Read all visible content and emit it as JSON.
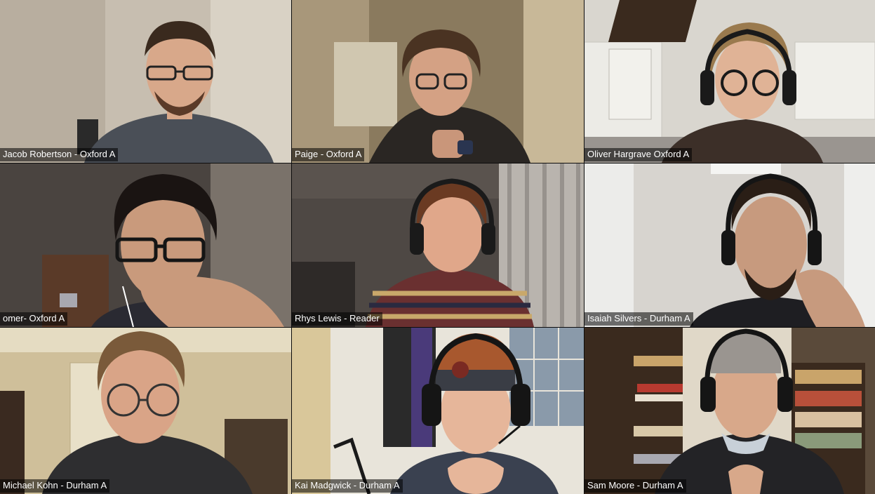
{
  "participants": [
    {
      "name": "Jacob Robertson - Oxford A",
      "bg": "#c9bfb0",
      "skin": "#d8a88a",
      "hair": "#3a2a1e",
      "shirt": "#4a4f57",
      "glasses": true,
      "headphones": false,
      "hat": false
    },
    {
      "name": "Paige - Oxford A",
      "bg": "#8c7a5c",
      "skin": "#d4a184",
      "hair": "#4a3322",
      "shirt": "#2a2623",
      "glasses": true,
      "headphones": false,
      "hat": false
    },
    {
      "name": "Oliver Hargrave Oxford A",
      "bg": "#d9d6cf",
      "skin": "#e0b396",
      "hair": "#9a7a4e",
      "shirt": "#3c2f28",
      "glasses": true,
      "headphones": true,
      "hat": false
    },
    {
      "name": "omer- Oxford A",
      "bg": "#4a4440",
      "skin": "#c99a7c",
      "hair": "#1a1412",
      "shirt": "#2a2a32",
      "glasses": true,
      "headphones": false,
      "hat": false
    },
    {
      "name": "Rhys Lewis - Reader",
      "bg": "#5c5650",
      "skin": "#e0a78a",
      "hair": "#6a3a22",
      "shirt": "#6a3030",
      "glasses": false,
      "headphones": true,
      "hat": false
    },
    {
      "name": "Isaiah Silvers - Durham A",
      "bg": "#d2cfca",
      "skin": "#c79a7e",
      "hair": "#2a1e16",
      "shirt": "#1e1e22",
      "glasses": false,
      "headphones": true,
      "hat": false
    },
    {
      "name": "Michael Kohn - Durham A",
      "bg": "#c9b792",
      "skin": "#d9a487",
      "hair": "#7a5a3a",
      "shirt": "#2e2e30",
      "glasses": true,
      "headphones": false,
      "hat": false
    },
    {
      "name": "Kai Madgwick - Durham A",
      "bg": "#e8e4da",
      "skin": "#e6b69a",
      "hair": "#7a4a2a",
      "shirt": "#3a4150",
      "glasses": false,
      "headphones": true,
      "hat": true,
      "hat_color": "#a8582e"
    },
    {
      "name": "Sam Moore - Durham A",
      "bg": "#5a4a3a",
      "skin": "#d8a88a",
      "hair": "#5a4030",
      "shirt": "#232326",
      "glasses": false,
      "headphones": true,
      "hat": true,
      "hat_color": "#9a9590"
    }
  ]
}
